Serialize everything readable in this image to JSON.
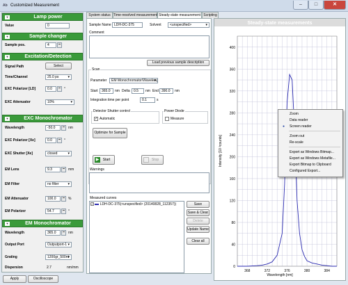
{
  "window": {
    "app_icon": "Ab",
    "title": "Customized Measurement",
    "min": "–",
    "max": "□",
    "close": "✕"
  },
  "left": {
    "lamp": {
      "title": "Lamp power",
      "value_label": "Value",
      "value": "0"
    },
    "sample_changer": {
      "title": "Sample changer",
      "pos_label": "Sample pos.",
      "pos": "4"
    },
    "excitation": {
      "title": "Excitation/Detection",
      "signal_path_label": "Signal Path",
      "select_btn": "Select",
      "time_channel_label": "Time/Channel",
      "time_channel": "25.0 ps",
      "polarizer_ld_label": "EXC Polarizer [LD]",
      "polarizer_ld": "0.0",
      "polarizer_ld_unit": "°",
      "attenuator_label": "EXC Attenuator",
      "attenuator": "10%"
    },
    "exc_mono": {
      "title": "EXC Monochromator",
      "wavelength_label": "Wavelength",
      "wavelength": "-50.0",
      "wavelength_unit": "nm",
      "polarizer_xe_label": "EXC Polarizer [Xe]",
      "polarizer_xe": "0.0",
      "polarizer_xe_unit": "°",
      "shutter_label": "EXC Shutter [Xe]",
      "shutter": "closed",
      "em_lens_label": "EM Lens",
      "em_lens": "9.3",
      "em_lens_unit": "mm",
      "em_filter_label": "EM Filter",
      "em_filter": "no filter",
      "em_attenuator_label": "EM Attenuator",
      "em_attenuator": "100.0",
      "em_attenuator_unit": "%",
      "em_polarizer_label": "EM Polarizer",
      "em_polarizer": "54.7",
      "em_polarizer_unit": "°"
    },
    "em_mono": {
      "title": "EM Monochromator",
      "wavelength_label": "Wavelength",
      "wavelength": "365.0",
      "wavelength_unit": "nm",
      "output_port_label": "Output Port",
      "output_port": "Outputport-1",
      "grating_label": "Grating",
      "grating": "1200gr_500nt",
      "dispersion_label": "Dispersion",
      "dispersion": "2.7",
      "dispersion_unit": "nm/mm"
    }
  },
  "bottom": {
    "apply": "Apply",
    "oscilloscope": "Oscilloscope"
  },
  "tabs": [
    "System status",
    "Time-resolved measurement",
    "Steady-state measurement",
    "Scripting"
  ],
  "sample": {
    "name_label": "Sample Name",
    "name": "LDH-DC-375",
    "solvent_label": "Solvent",
    "solvent": "<unspecified>",
    "comment_label": "Comment",
    "load_btn": "Load previous sample description"
  },
  "scan": {
    "title": "Scan",
    "param_label": "Parameter",
    "param": "EM Monochromator/Wavelength",
    "start_label": "Start",
    "start": "365.0",
    "start_unit": "nm",
    "delta_label": "Delta",
    "delta": "0.5",
    "delta_unit": "nm",
    "end_label": "End",
    "end": "390.0",
    "end_unit": "nm",
    "itime_label": "Integration time per point",
    "itime": "0.1",
    "itime_unit": "s",
    "shutter_ctrl_title": "Detector Shutter control",
    "automatic": "Automatic",
    "power_diode_title": "Power Diode",
    "measure": "Measure",
    "optimize_btn": "Optimize for Sample",
    "start_btn": "Start",
    "stop_btn": "Stop"
  },
  "warnings": {
    "title": "Warnings"
  },
  "curves": {
    "title": "Measured curves",
    "item": "LDH-DC-375(<unspecified> (20140828_112357))",
    "save": "Save",
    "save_close": "Save & Clear",
    "delete": "Delete",
    "update": "Update Name",
    "clear_all": "Clear all"
  },
  "plot": {
    "title": "Steady-state measurements",
    "ylabel": "Intensity [10 ³counts]",
    "xlabel": "Wavelength [nm]",
    "yticks": [
      "0",
      "40",
      "80",
      "120",
      "160",
      "200",
      "240",
      "280",
      "320",
      "360",
      "400"
    ],
    "xticks": [
      "368",
      "372",
      "376",
      "380",
      "384"
    ]
  },
  "chart_data": {
    "type": "line",
    "title": "Steady-state measurements",
    "xlabel": "Wavelength [nm]",
    "ylabel": "Intensity [10 ³counts]",
    "xlim": [
      366,
      386
    ],
    "ylim": [
      0,
      420
    ],
    "grid": true,
    "color": "#2a2ab0",
    "x": [
      366,
      368,
      370,
      371,
      372,
      373,
      374,
      375,
      375.5,
      376,
      376.5,
      377,
      377.5,
      378,
      378.5,
      379,
      379.5,
      380,
      381,
      382,
      383,
      384,
      385,
      386
    ],
    "values": [
      0,
      0,
      1,
      2,
      4,
      8,
      20,
      60,
      150,
      300,
      350,
      340,
      250,
      120,
      60,
      30,
      18,
      10,
      6,
      4,
      2,
      1,
      0,
      0
    ]
  },
  "context_menu": {
    "items": [
      "Zoom",
      "Data reader",
      "Screen reader",
      "Zoom out",
      "Re-scale",
      "Export as Windows Bitmap...",
      "Export as Windows Metafile...",
      "Export Bitmap to Clipboard",
      "Configured Export..."
    ],
    "selected": 2
  }
}
